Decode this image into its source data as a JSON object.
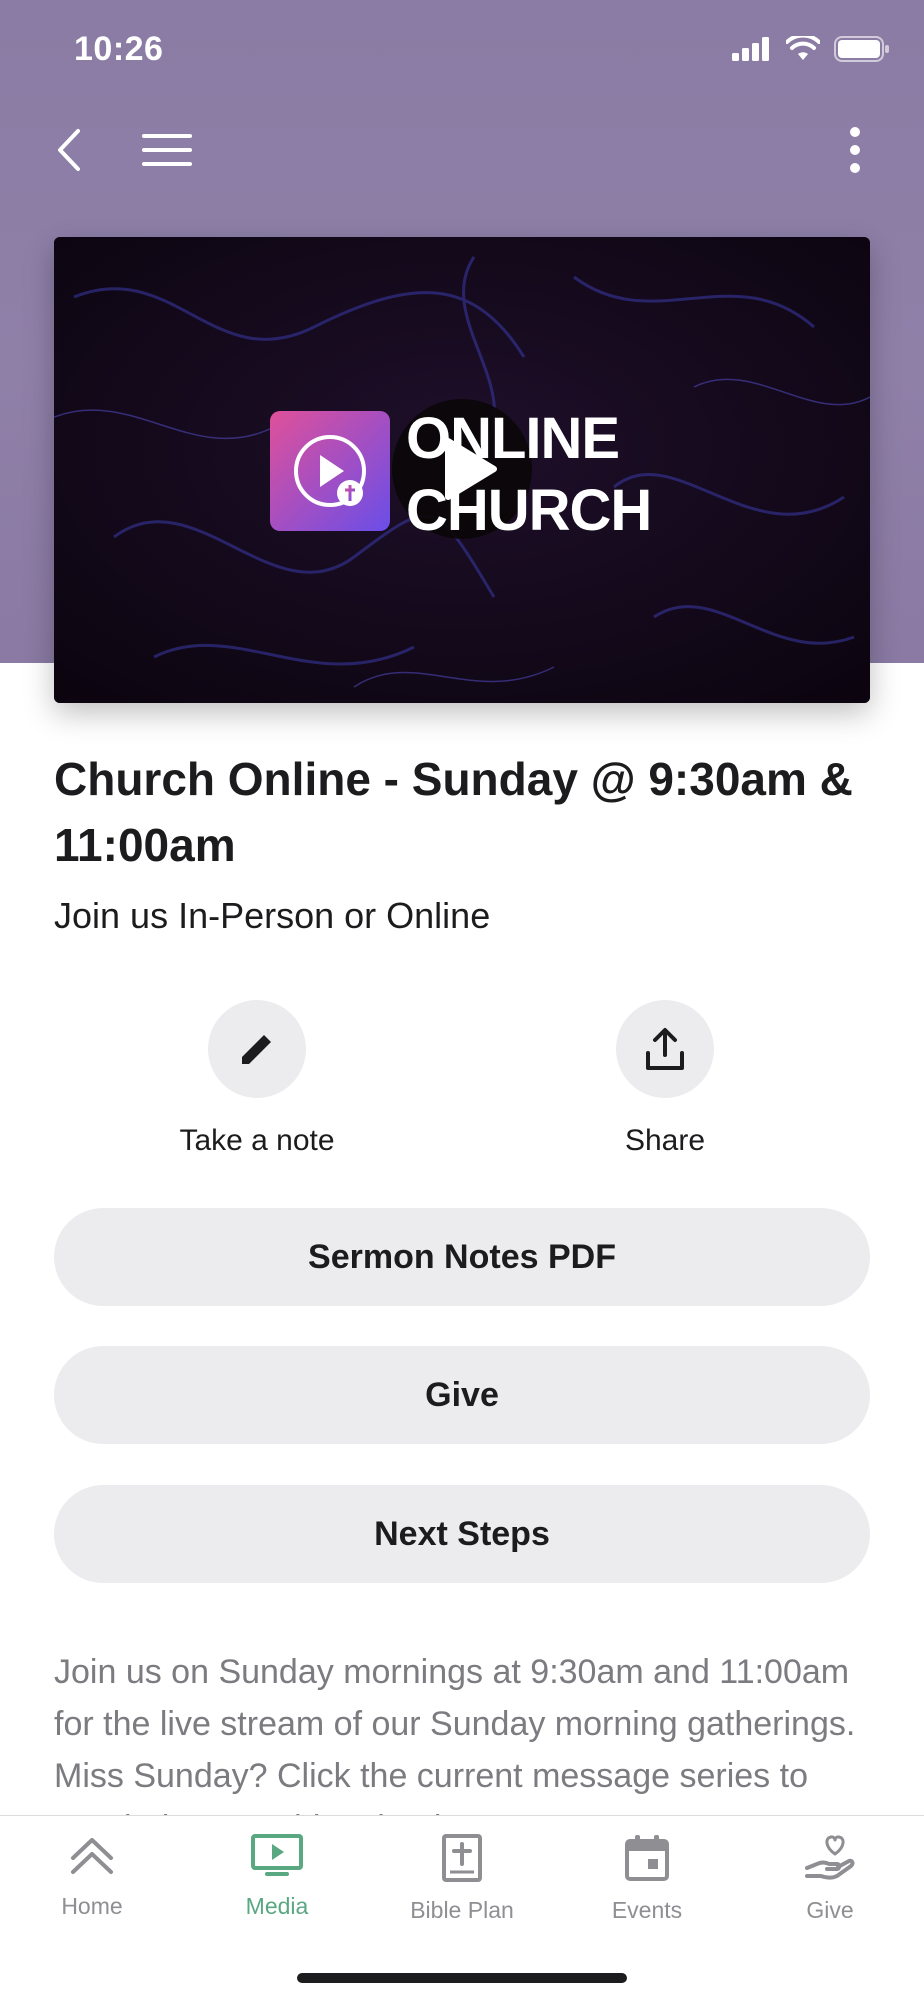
{
  "status_bar": {
    "time": "10:26"
  },
  "header": {
    "back_icon": "chevron-left-icon",
    "menu_icon": "hamburger-icon",
    "more_icon": "vertical-ellipsis-icon",
    "background": "#8a7ca4"
  },
  "video": {
    "thumbnail_text_line1": "ONLINE",
    "thumbnail_text_line2": "CHURCH",
    "play_icon": "play-icon"
  },
  "content": {
    "title": "Church Online - Sunday @ 9:30am & 11:00am",
    "subtitle": "Join us In-Person or Online"
  },
  "actions": [
    {
      "label": "Take a note",
      "icon": "pencil-icon"
    },
    {
      "label": "Share",
      "icon": "share-icon"
    }
  ],
  "buttons": [
    {
      "label": "Sermon Notes PDF"
    },
    {
      "label": "Give"
    },
    {
      "label": "Next Steps"
    }
  ],
  "description": "Join us on Sunday mornings at 9:30am and 11:00am for the live stream of our Sunday morning gatherings. Miss Sunday? Click the current message series to watch the preaching that is",
  "tabbar": {
    "accent": "#5aa882",
    "items": [
      {
        "label": "Home",
        "icon": "chevrons-up-icon",
        "active": false
      },
      {
        "label": "Media",
        "icon": "tv-play-icon",
        "active": true
      },
      {
        "label": "Bible Plan",
        "icon": "bible-icon",
        "active": false
      },
      {
        "label": "Events",
        "icon": "calendar-icon",
        "active": false
      },
      {
        "label": "Give",
        "icon": "heart-hand-icon",
        "active": false
      }
    ]
  }
}
